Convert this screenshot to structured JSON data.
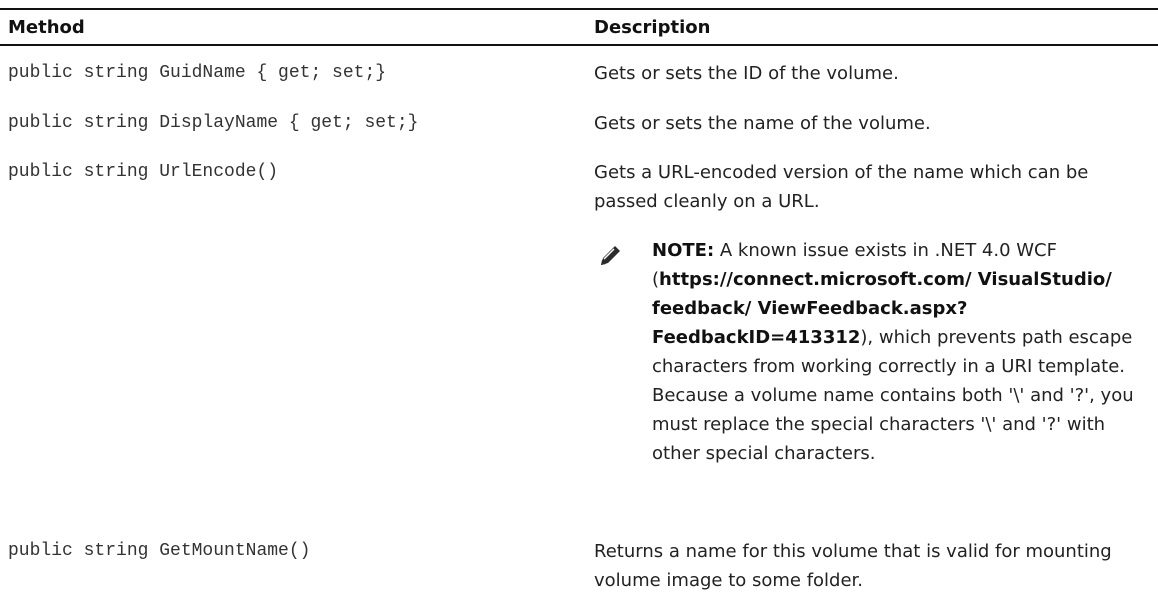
{
  "headers": {
    "method": "Method",
    "description": "Description"
  },
  "rows": [
    {
      "method": "public string GuidName { get; set;}",
      "description": "Gets or sets the ID of the volume."
    },
    {
      "method": "public string DisplayName { get; set;}",
      "description": "Gets or sets the name of the volume."
    },
    {
      "method": "public string UrlEncode()",
      "description": "Gets a URL-encoded version of the name which can be passed cleanly on a URL."
    },
    {
      "method": "public string GetMountName()",
      "description": "Returns a name for this volume that is valid for mounting volume image to some folder."
    }
  ],
  "note": {
    "icon": "pencil-note-icon",
    "label": "NOTE:",
    "text_before": " A known issue exists in .NET 4.0 WCF (",
    "link": "https://connect.microsoft.com/ VisualStudio/ feedback/ ViewFeedback.aspx? FeedbackID=413312",
    "text_after": "), which prevents path escape characters from working correctly in a URI template. Because a volume name contains both '\\' and '?', you must replace the special characters '\\' and '?' with other special characters."
  }
}
